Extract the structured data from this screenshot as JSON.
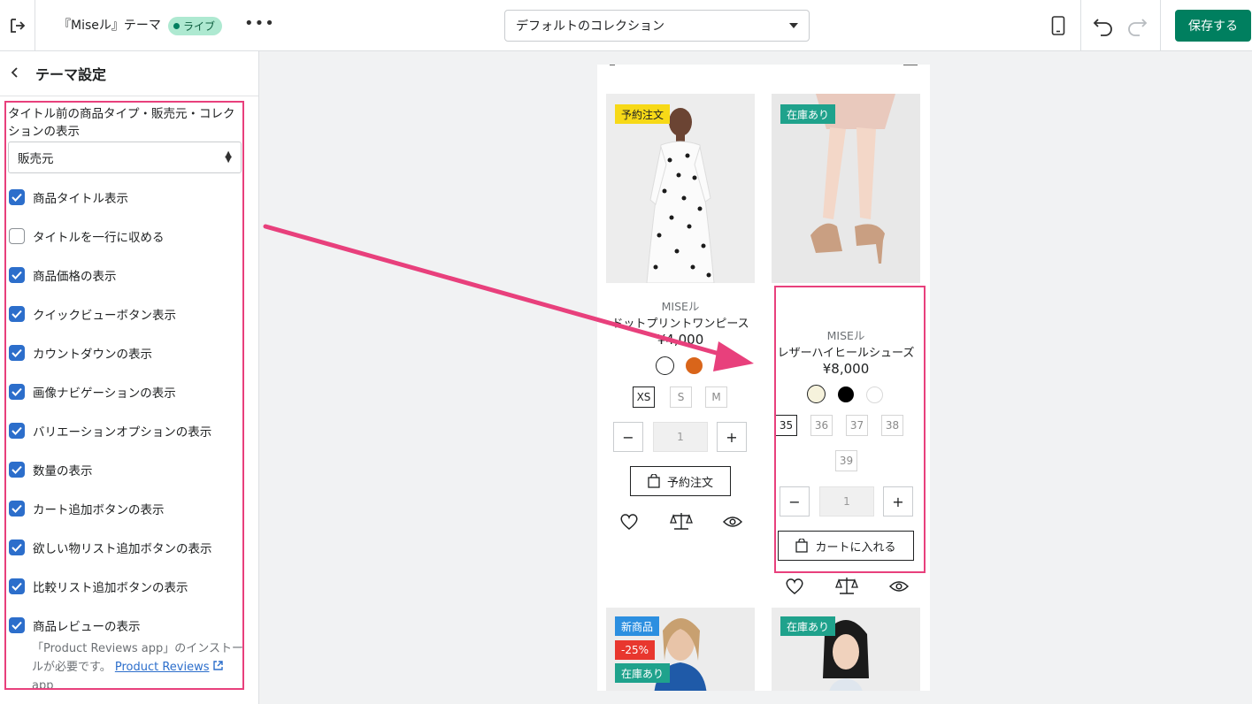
{
  "header": {
    "theme_name": "『Miseル』テーマ",
    "live_badge": "ライブ",
    "more": "•••",
    "collection_select": "デフォルトのコレクション",
    "save": "保存する"
  },
  "sidebar": {
    "title": "テーマ設定",
    "type_label": "タイトル前の商品タイプ・販売元・コレクションの表示",
    "type_value": "販売元",
    "checkboxes": [
      {
        "label": "商品タイトル表示",
        "checked": true
      },
      {
        "label": "タイトルを一行に収める",
        "checked": false
      },
      {
        "label": "商品価格の表示",
        "checked": true
      },
      {
        "label": "クイックビューボタン表示",
        "checked": true
      },
      {
        "label": "カウントダウンの表示",
        "checked": true
      },
      {
        "label": "画像ナビゲーションの表示",
        "checked": true
      },
      {
        "label": "バリエーションオプションの表示",
        "checked": true
      },
      {
        "label": "数量の表示",
        "checked": true
      },
      {
        "label": "カート追加ボタンの表示",
        "checked": true
      },
      {
        "label": "欲しい物リスト追加ボタンの表示",
        "checked": true
      },
      {
        "label": "比較リスト追加ボタンの表示",
        "checked": true
      },
      {
        "label": "商品レビューの表示",
        "checked": true
      }
    ],
    "review_help": "「Product Reviews app」のインストールが必要です。",
    "review_link": "Product Reviews",
    "review_link_suffix": "app"
  },
  "products": [
    {
      "badge": "予約注文",
      "badge_color": "#f7d917",
      "brand": "MISEル",
      "name": "ドットプリントワンピース",
      "price": "¥4,000",
      "swatches": [
        "#ffffff",
        "#d9651a"
      ],
      "sizes": [
        "XS",
        "S",
        "M"
      ],
      "qty": "1",
      "button": "予約注文"
    },
    {
      "badge": "在庫あり",
      "badge_color": "#1fa28c",
      "brand": "MISEル",
      "name": "レザーハイヒールシューズ",
      "price": "¥8,000",
      "swatches": [
        "#f6f2dc",
        "#000000",
        "#ffffff"
      ],
      "sizes": [
        "35",
        "36",
        "37",
        "38",
        "39"
      ],
      "qty": "1",
      "button": "カートに入れる"
    }
  ],
  "bottom_badges": {
    "left": [
      "新商品",
      "-25%",
      "在庫あり"
    ],
    "right": [
      "在庫あり"
    ]
  },
  "colors": {
    "accent": "#007f5f",
    "highlight": "#e8407c",
    "checkbox": "#2c6ecb"
  }
}
